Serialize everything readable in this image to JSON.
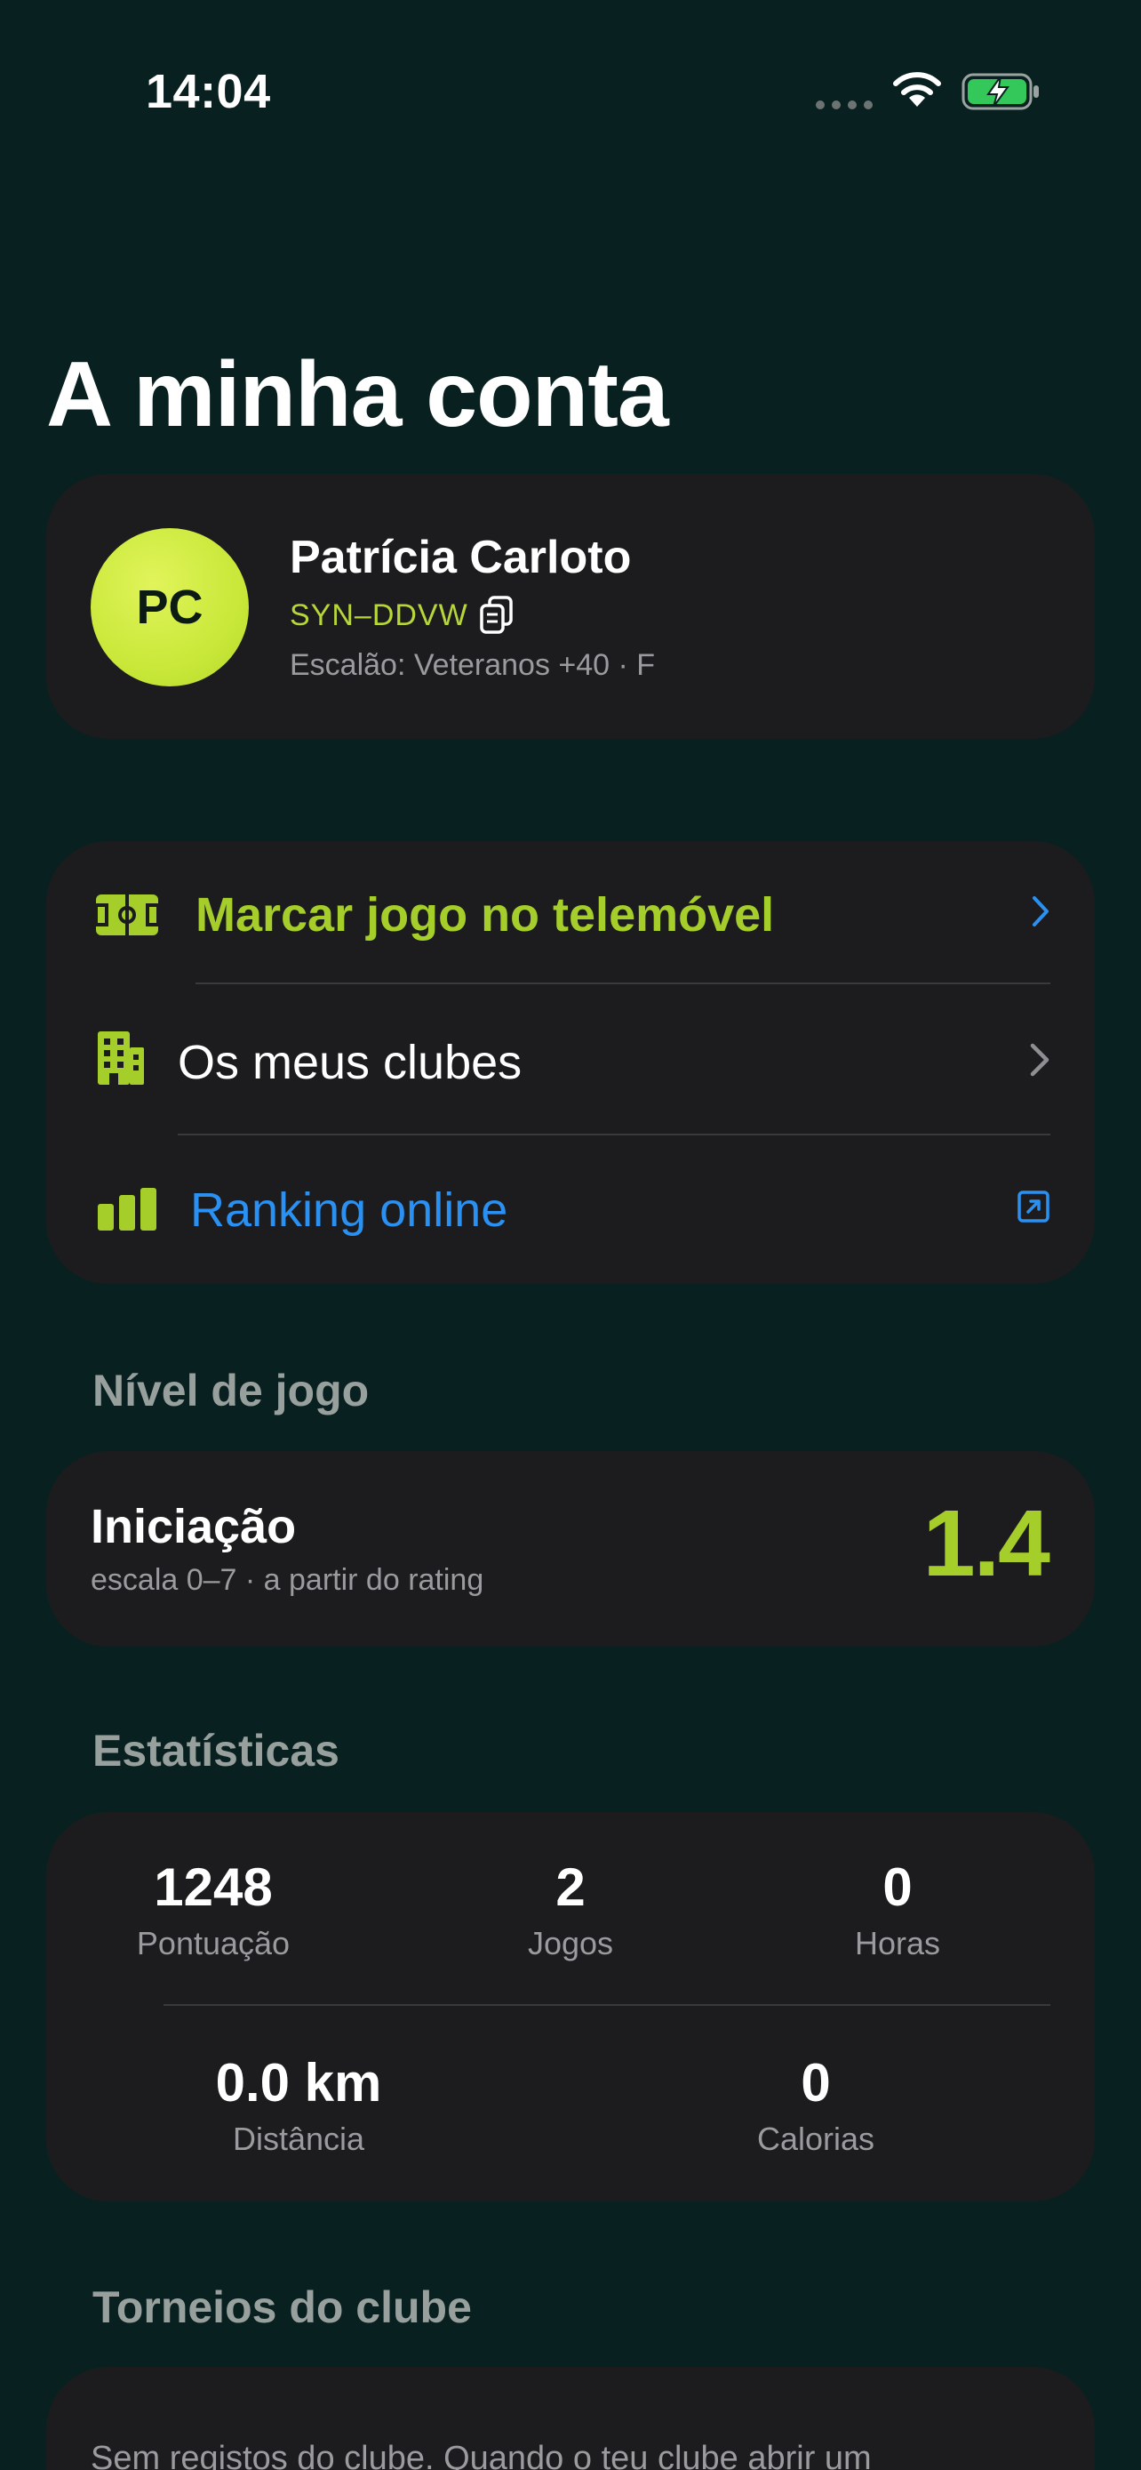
{
  "status_bar": {
    "time": "14:04"
  },
  "page": {
    "title": "A minha conta"
  },
  "profile": {
    "initials": "PC",
    "name": "Patrícia Carloto",
    "code": "SYN–DDVW",
    "tier": "Escalão: Veteranos +40 · F"
  },
  "menu": {
    "items": [
      {
        "label": "Marcar jogo no telemóvel",
        "icon": "court-icon",
        "color": "#A6CE2B"
      },
      {
        "label": "Os meus clubes",
        "icon": "building-icon",
        "color": "#FFFFFF"
      },
      {
        "label": "Ranking online",
        "icon": "bar-chart-icon",
        "color": "#2A91F2"
      }
    ]
  },
  "level": {
    "section_title": "Nível de jogo",
    "name": "Iniciação",
    "subtitle": "escala 0–7 · a partir do rating",
    "value": "1.4"
  },
  "stats": {
    "section_title": "Estatísticas",
    "row1": [
      {
        "value": "1248",
        "label": "Pontuação"
      },
      {
        "value": "2",
        "label": "Jogos"
      },
      {
        "value": "0",
        "label": "Horas"
      }
    ],
    "row2": [
      {
        "value": "0.0 km",
        "label": "Distância"
      },
      {
        "value": "0",
        "label": "Calorias"
      }
    ]
  },
  "tournaments": {
    "section_title": "Torneios do clube",
    "empty_text": "Sem registos do clube. Quando o teu clube abrir um"
  },
  "colors": {
    "background": "#08201F",
    "card": "#1C1C1E",
    "accent": "#A6CE2B",
    "link": "#2A91F2"
  }
}
